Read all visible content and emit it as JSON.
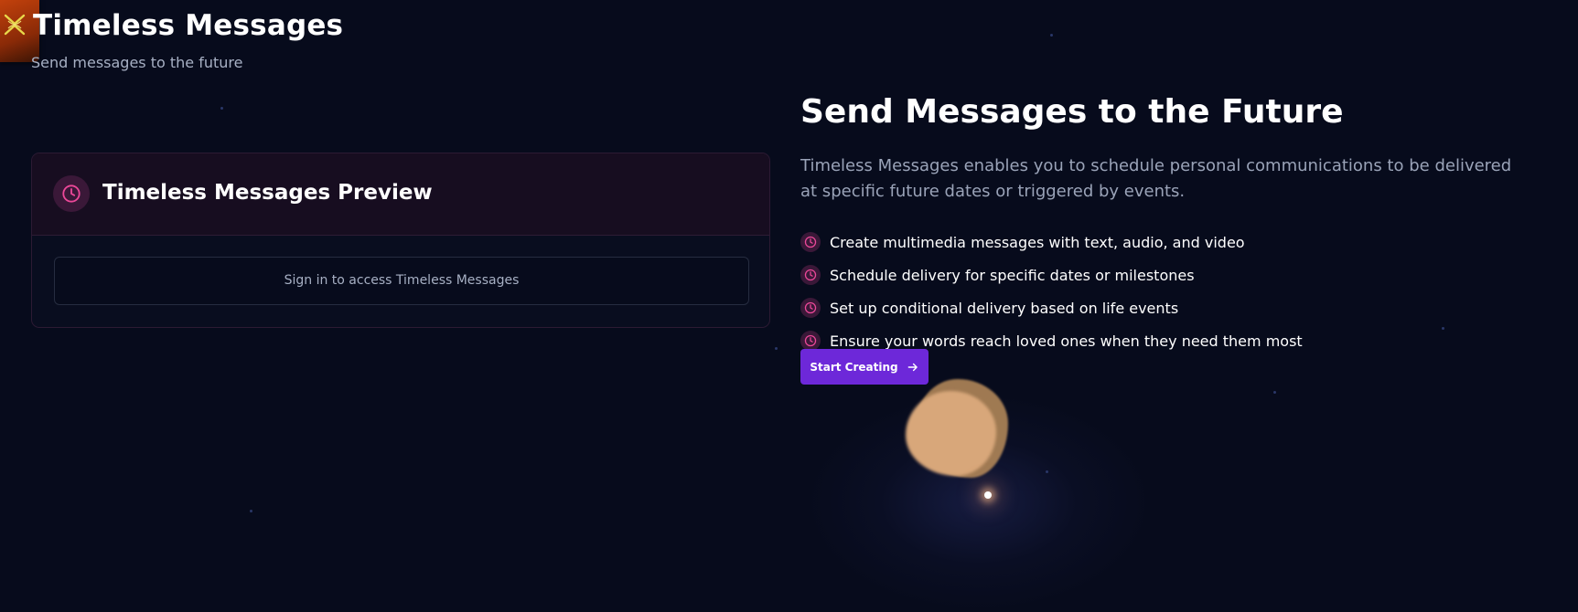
{
  "header": {
    "title": "Timeless Messages",
    "subtitle": "Send messages to the future"
  },
  "logo": {
    "icon": "x-logo-icon",
    "color": "#c2410c"
  },
  "preview": {
    "title": "Timeless Messages Preview",
    "icon": "clock-icon",
    "signin_text": "Sign in to access Timeless Messages"
  },
  "hero": {
    "title": "Send Messages to the Future",
    "description": "Timeless Messages enables you to schedule personal communications to be delivered at specific future dates or triggered by events.",
    "features": [
      {
        "label": "Create multimedia messages with text, audio, and video",
        "icon": "clock-icon"
      },
      {
        "label": "Schedule delivery for specific dates or milestones",
        "icon": "clock-icon"
      },
      {
        "label": "Set up conditional delivery based on life events",
        "icon": "clock-icon"
      },
      {
        "label": "Ensure your words reach loved ones when they need them most",
        "icon": "clock-icon"
      }
    ],
    "cta_label": "Start Creating",
    "cta_icon": "arrow-right-icon"
  },
  "colors": {
    "background": "#070b1c",
    "accent_pink": "#ec4899",
    "accent_purple": "#6d28d9",
    "brand_orange": "#c2410c"
  }
}
